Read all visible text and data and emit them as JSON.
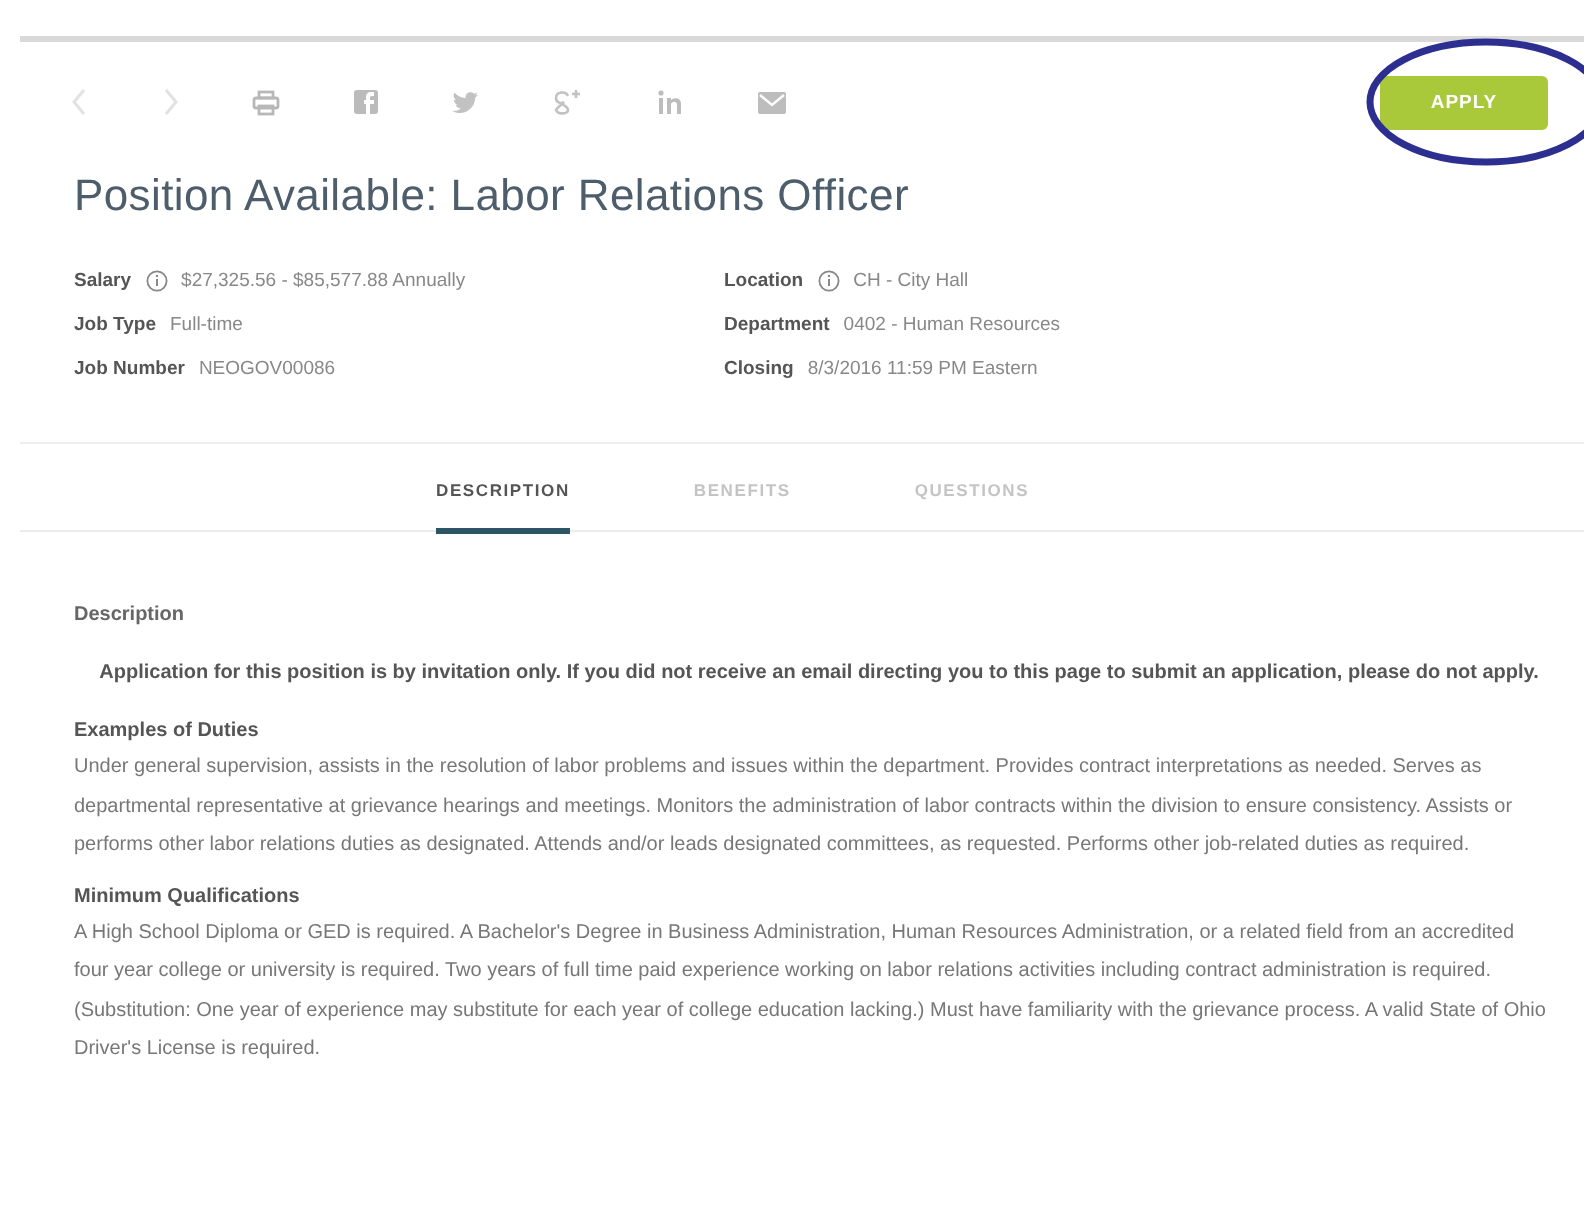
{
  "toolbar": {
    "apply_button": "APPLY"
  },
  "title": "Position Available: Labor Relations Officer",
  "details": [
    {
      "label": "Salary",
      "value": "$27,325.56 - $85,577.88 Annually",
      "info": true
    },
    {
      "label": "Location",
      "value": "CH - City Hall",
      "info": true
    },
    {
      "label": "Job Type",
      "value": "Full-time",
      "info": false
    },
    {
      "label": "Department",
      "value": "0402 - Human Resources",
      "info": false
    },
    {
      "label": "Job Number",
      "value": "NEOGOV00086",
      "info": false
    },
    {
      "label": "Closing",
      "value": "8/3/2016 11:59 PM Eastern",
      "info": false
    }
  ],
  "tabs": [
    {
      "label": "DESCRIPTION",
      "selected": true
    },
    {
      "label": "BENEFITS",
      "selected": false
    },
    {
      "label": "QUESTIONS",
      "selected": false
    }
  ],
  "content": {
    "section_label": "Description",
    "notice": "Application for this position is by invitation only. If you did not receive an email directing you to this page to submit an application, please do not apply.",
    "sections": [
      {
        "heading": "Examples of Duties",
        "body": "Under general supervision, assists in the resolution of labor problems and issues within the department. Provides contract interpretations as needed. Serves as departmental representative at grievance hearings and meetings. Monitors the administration of labor contracts within the division to ensure consistency. Assists or performs other labor relations duties as designated. Attends and/or leads designated committees, as requested. Performs other job-related duties as required."
      },
      {
        "heading": "Minimum Qualifications",
        "body": "A High School Diploma or GED is required. A Bachelor's Degree in Business Administration, Human Resources Administration, or a related field from an accredited four year college or university is required. Two years of full time paid experience working on labor relations activities including contract administration is required. (Substitution: One year of experience may substitute for each year of college education lacking.) Must have familiarity with the grievance process. A valid State of Ohio Driver's License is required."
      }
    ]
  }
}
